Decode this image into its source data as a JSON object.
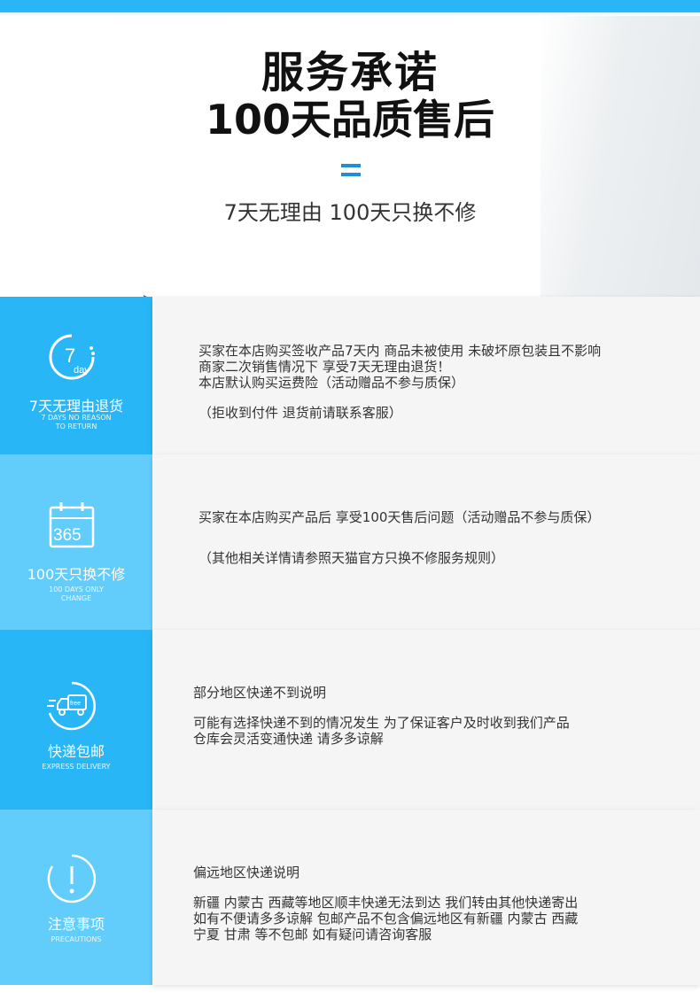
{
  "header": {
    "title_line1": "服务承诺",
    "title_line2": "100天品质售后",
    "subtitle": "7天无理由 100天只换不修"
  },
  "colors": {
    "accent": "#29b6f6",
    "accent_light": "#62cdfb",
    "divider": "#1e8fd6"
  },
  "sections": [
    {
      "icon": "7-day-icon",
      "icon_text_num": "7",
      "icon_text_unit": "day",
      "label_cn": "7天无理由退货",
      "label_en_1": "7 DAYS NO REASON",
      "label_en_2": "TO RETURN",
      "lines": [
        "买家在本店购买签收产品7天内 商品未被使用 未破坏原包装且不影响",
        "商家二次销售情况下 享受7天无理由退货！",
        "本店默认购买运费险（活动赠品不参与质保）",
        "（拒收到付件 退货前请联系客服）"
      ]
    },
    {
      "icon": "calendar-icon",
      "icon_text_num": "365",
      "label_cn": "100天只换不修",
      "label_en_1": "100 DAYS ONLY",
      "label_en_2": "CHANGE",
      "lines": [
        "买家在本店购买产品后  享受100天售后问题（活动赠品不参与质保）",
        "（其他相关详情请参照天猫官方只换不修服务规则）"
      ]
    },
    {
      "icon": "delivery-truck-icon",
      "icon_text_free": "free",
      "label_cn": "快递包邮",
      "label_en_1": "EXPRESS DELIVERY",
      "lines": [
        "部分地区快递不到说明",
        "可能有选择快递不到的情况发生 为了保证客户及时收到我们产品",
        "仓库会灵活变通快递 请多多谅解"
      ]
    },
    {
      "icon": "exclamation-icon",
      "label_cn": "注意事项",
      "label_en_1": "PRECAUTIONS",
      "lines": [
        "偏远地区快递说明",
        "新疆 内蒙古 西藏等地区顺丰快递无法到达 我们转由其他快递寄出",
        "如有不便请多多谅解  包邮产品不包含偏远地区有新疆 内蒙古 西藏",
        "宁夏 甘肃 等不包邮 如有疑问请咨询客服"
      ]
    }
  ]
}
